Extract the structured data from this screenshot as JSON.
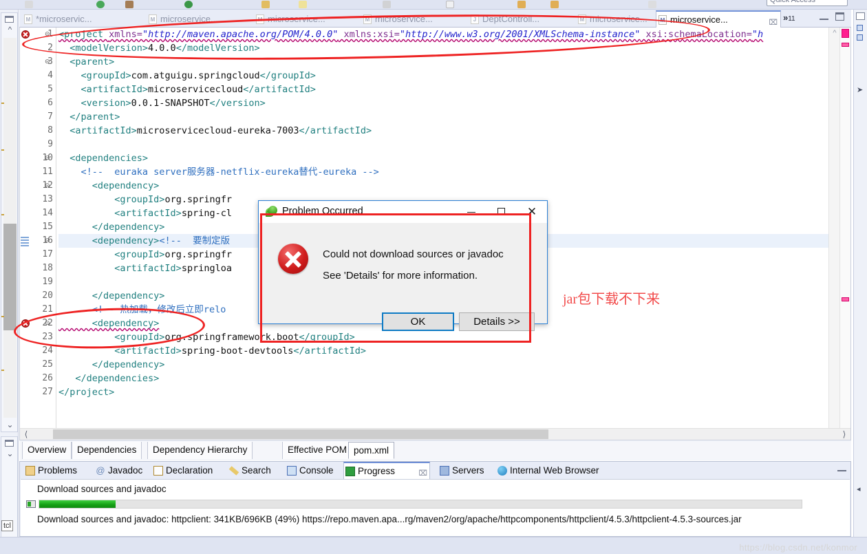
{
  "toolbar": {
    "quick_access_label": "Quick Access",
    "icons": [
      "save-icon",
      "run-icon",
      "debug-icon",
      "coverage-icon",
      "new-folder-icon",
      "open-folder-icon",
      "edit-icon",
      "terminal-icon",
      "new-window-icon",
      "pin-icon",
      "pin2-icon",
      "perspective-icon"
    ]
  },
  "editor_tabs": {
    "items": [
      {
        "label": "*microservic...",
        "dirty": true,
        "active": false
      },
      {
        "label": "microservice...",
        "dirty": false,
        "active": false
      },
      {
        "label": "microservice...",
        "dirty": false,
        "active": false
      },
      {
        "label": "microservice...",
        "dirty": false,
        "active": false
      },
      {
        "label": "DeptControll...",
        "dirty": false,
        "active": false
      },
      {
        "label": "microservice...",
        "dirty": false,
        "active": false
      },
      {
        "label": "microservice...",
        "dirty": false,
        "active": true
      }
    ],
    "overflow_marker": "»",
    "overflow_count": "11",
    "close_glyph": "⌧"
  },
  "code": {
    "lines": [
      {
        "num": "1",
        "fold": "⊝",
        "error": true,
        "highlight": false,
        "segments": [
          {
            "t": "<project ",
            "c": "tag"
          },
          {
            "t": "xmlns=",
            "c": "attr"
          },
          {
            "t": "\"http://maven.apache.org/POM/4.0.0\"",
            "c": "val"
          },
          {
            "t": " xmlns:xsi=",
            "c": "attr"
          },
          {
            "t": "\"http://www.w3.org/2001/XMLSchema-instance\"",
            "c": "val"
          },
          {
            "t": " xsi:schemaLocation=",
            "c": "attr"
          },
          {
            "t": "\"h",
            "c": "val"
          }
        ]
      },
      {
        "num": "2",
        "fold": "",
        "error": false,
        "highlight": false,
        "segments": [
          {
            "t": "  <modelVersion>",
            "c": "tag"
          },
          {
            "t": "4.0.0",
            "c": "txt"
          },
          {
            "t": "</modelVersion>",
            "c": "tag"
          }
        ]
      },
      {
        "num": "3",
        "fold": "⊝",
        "error": false,
        "highlight": false,
        "segments": [
          {
            "t": "  <parent>",
            "c": "tag"
          }
        ]
      },
      {
        "num": "4",
        "fold": "",
        "error": false,
        "highlight": false,
        "segments": [
          {
            "t": "    <groupId>",
            "c": "tag"
          },
          {
            "t": "com.atguigu.springcloud",
            "c": "txt"
          },
          {
            "t": "</groupId>",
            "c": "tag"
          }
        ]
      },
      {
        "num": "5",
        "fold": "",
        "error": false,
        "highlight": false,
        "segments": [
          {
            "t": "    <artifactId>",
            "c": "tag"
          },
          {
            "t": "microservicecloud",
            "c": "txt"
          },
          {
            "t": "</artifactId>",
            "c": "tag"
          }
        ]
      },
      {
        "num": "6",
        "fold": "",
        "error": false,
        "highlight": false,
        "segments": [
          {
            "t": "    <version>",
            "c": "tag"
          },
          {
            "t": "0.0.1-SNAPSHOT",
            "c": "txt"
          },
          {
            "t": "</version>",
            "c": "tag"
          }
        ]
      },
      {
        "num": "7",
        "fold": "",
        "error": false,
        "highlight": false,
        "segments": [
          {
            "t": "  </parent>",
            "c": "tag"
          }
        ]
      },
      {
        "num": "8",
        "fold": "",
        "error": false,
        "highlight": false,
        "segments": [
          {
            "t": "  <artifactId>",
            "c": "tag"
          },
          {
            "t": "microservicecloud-eureka-7003",
            "c": "txt"
          },
          {
            "t": "</artifactId>",
            "c": "tag"
          }
        ]
      },
      {
        "num": "9",
        "fold": "",
        "error": false,
        "highlight": false,
        "segments": []
      },
      {
        "num": "10",
        "fold": "⊝",
        "error": false,
        "highlight": false,
        "segments": [
          {
            "t": "  <dependencies>",
            "c": "tag"
          }
        ]
      },
      {
        "num": "11",
        "fold": "",
        "error": false,
        "highlight": false,
        "segments": [
          {
            "t": "    <!--  euraka server服务器-netflix-eureka替代-eureka -->",
            "c": "cmt"
          }
        ]
      },
      {
        "num": "12",
        "fold": "⊝",
        "error": false,
        "highlight": false,
        "segments": [
          {
            "t": "      <dependency>",
            "c": "tag"
          }
        ]
      },
      {
        "num": "13",
        "fold": "",
        "error": false,
        "highlight": false,
        "segments": [
          {
            "t": "          <groupId>",
            "c": "tag"
          },
          {
            "t": "org.springfr",
            "c": "txt"
          }
        ]
      },
      {
        "num": "14",
        "fold": "",
        "error": false,
        "highlight": false,
        "segments": [
          {
            "t": "          <artifactId>",
            "c": "tag"
          },
          {
            "t": "spring-cl",
            "c": "txt"
          }
        ]
      },
      {
        "num": "15",
        "fold": "",
        "error": false,
        "highlight": false,
        "segments": [
          {
            "t": "      </dependency>",
            "c": "tag"
          }
        ]
      },
      {
        "num": "16",
        "fold": "⊝",
        "error": false,
        "highlight": true,
        "segments": [
          {
            "t": "      <dependency>",
            "c": "tag"
          },
          {
            "t": "<!--  要制定版",
            "c": "cmt"
          }
        ]
      },
      {
        "num": "17",
        "fold": "",
        "error": false,
        "highlight": false,
        "segments": [
          {
            "t": "          <groupId>",
            "c": "tag"
          },
          {
            "t": "org.springfr",
            "c": "txt"
          }
        ]
      },
      {
        "num": "18",
        "fold": "",
        "error": false,
        "highlight": false,
        "segments": [
          {
            "t": "          <artifactId>",
            "c": "tag"
          },
          {
            "t": "springloa",
            "c": "txt"
          }
        ]
      },
      {
        "num": "19",
        "fold": "",
        "error": false,
        "highlight": false,
        "segments": []
      },
      {
        "num": "20",
        "fold": "",
        "error": false,
        "highlight": false,
        "segments": [
          {
            "t": "      </dependency>",
            "c": "tag"
          }
        ]
      },
      {
        "num": "21",
        "fold": "",
        "error": false,
        "highlight": false,
        "segments": [
          {
            "t": "      <!-- 热加载，修改后立即relo",
            "c": "cmt"
          }
        ]
      },
      {
        "num": "22",
        "fold": "⊝",
        "error": true,
        "highlight": false,
        "segments": [
          {
            "t": "      <dependency>",
            "c": "tag"
          }
        ]
      },
      {
        "num": "23",
        "fold": "",
        "error": false,
        "highlight": false,
        "segments": [
          {
            "t": "          <groupId>",
            "c": "tag"
          },
          {
            "t": "org.springframework.boot",
            "c": "txt"
          },
          {
            "t": "</groupId>",
            "c": "tag"
          }
        ]
      },
      {
        "num": "24",
        "fold": "",
        "error": false,
        "highlight": false,
        "segments": [
          {
            "t": "          <artifactId>",
            "c": "tag"
          },
          {
            "t": "spring-boot-devtools",
            "c": "txt"
          },
          {
            "t": "</artifactId>",
            "c": "tag"
          }
        ]
      },
      {
        "num": "25",
        "fold": "",
        "error": false,
        "highlight": false,
        "segments": [
          {
            "t": "      </dependency>",
            "c": "tag"
          }
        ]
      },
      {
        "num": "26",
        "fold": "",
        "error": false,
        "highlight": false,
        "segments": [
          {
            "t": "   </dependencies>",
            "c": "tag"
          }
        ]
      },
      {
        "num": "27",
        "fold": "",
        "error": false,
        "highlight": false,
        "segments": [
          {
            "t": "</project>",
            "c": "tag"
          }
        ]
      }
    ]
  },
  "page_tabs": {
    "items": [
      "Overview",
      "Dependencies",
      "Dependency Hierarchy",
      "Effective POM",
      "pom.xml"
    ],
    "active": "pom.xml"
  },
  "bottom_views": {
    "items": [
      {
        "label": "Problems",
        "icon": "problems-icon",
        "active": false
      },
      {
        "label": "Javadoc",
        "icon": "javadoc-icon",
        "active": false
      },
      {
        "label": "Declaration",
        "icon": "declaration-icon",
        "active": false
      },
      {
        "label": "Search",
        "icon": "search-icon",
        "active": false
      },
      {
        "label": "Console",
        "icon": "console-icon",
        "active": false
      },
      {
        "label": "Progress",
        "icon": "progress-icon",
        "active": true
      },
      {
        "label": "Servers",
        "icon": "servers-icon",
        "active": false
      },
      {
        "label": "Internal Web Browser",
        "icon": "globe-icon",
        "active": false
      }
    ],
    "close_glyph": "⌧"
  },
  "progress": {
    "job_title": "Download sources and javadoc",
    "percent": 10,
    "detail": "Download sources and javadoc: httpclient: 341KB/696KB (49%) https://repo.maven.apa...rg/maven2/org/apache/httpcomponents/httpclient/4.5.3/httpclient-4.5.3-sources.jar",
    "downloaded": "341KB",
    "total": "696KB",
    "file_percent": "49%"
  },
  "dialog": {
    "title": "Problem Occurred",
    "message_line1": "Could not download sources or javadoc",
    "message_line2": "See 'Details' for more information.",
    "ok_label": "OK",
    "details_label": "Details >>",
    "minimize_glyph": "—",
    "maximize_glyph": "□",
    "close_glyph": "✕"
  },
  "annotations": {
    "note_text": "jar包下载不下来",
    "color": "#ee2222"
  },
  "watermark": {
    "text": "https://blog.csdn.net/konmor"
  },
  "colors": {
    "accent": "#2b7fd4",
    "error": "#cc2222",
    "progress_green": "#17a117",
    "annotation_red": "#ee2222",
    "tag": "#1f7f7f",
    "attr": "#7f2f8f",
    "value": "#2222cc",
    "comment": "#2f6fbf"
  }
}
